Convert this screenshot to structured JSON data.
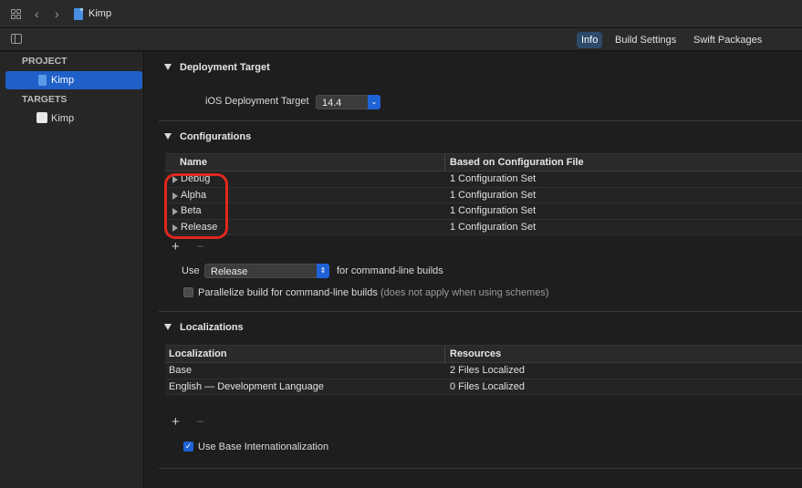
{
  "titlebar": {
    "title": "Kimp"
  },
  "tabs": [
    {
      "label": "Info",
      "active": true
    },
    {
      "label": "Build Settings",
      "active": false
    },
    {
      "label": "Swift Packages",
      "active": false
    }
  ],
  "sidebar": {
    "project_header": "PROJECT",
    "project_item": "Kimp",
    "targets_header": "TARGETS",
    "target_item": "Kimp"
  },
  "deployment": {
    "title": "Deployment Target",
    "ios_label": "iOS Deployment Target",
    "ios_value": "14.4"
  },
  "configurations": {
    "title": "Configurations",
    "columns": [
      "Name",
      "Based on Configuration File"
    ],
    "rows": [
      {
        "name": "Debug",
        "file": "1 Configuration Set"
      },
      {
        "name": "Alpha",
        "file": "1 Configuration Set"
      },
      {
        "name": "Beta",
        "file": "1 Configuration Set"
      },
      {
        "name": "Release",
        "file": "1 Configuration Set"
      }
    ],
    "use_label": "Use",
    "use_value": "Release",
    "use_suffix": "for command-line builds",
    "parallelize_label": "Parallelize build for command-line builds",
    "parallelize_note": "(does not apply when using schemes)"
  },
  "localizations": {
    "title": "Localizations",
    "columns": [
      "Localization",
      "Resources"
    ],
    "rows": [
      {
        "name": "Base",
        "resources": "2 Files Localized"
      },
      {
        "name": "English — Development Language",
        "resources": "0 Files Localized"
      }
    ],
    "base_intl_label": "Use Base Internationalization"
  },
  "icons": {
    "plus": "+",
    "minus": "−",
    "chevron_left": "‹",
    "chevron_right": "›",
    "check": "✓",
    "popup_arrows": "⌃⌄"
  }
}
